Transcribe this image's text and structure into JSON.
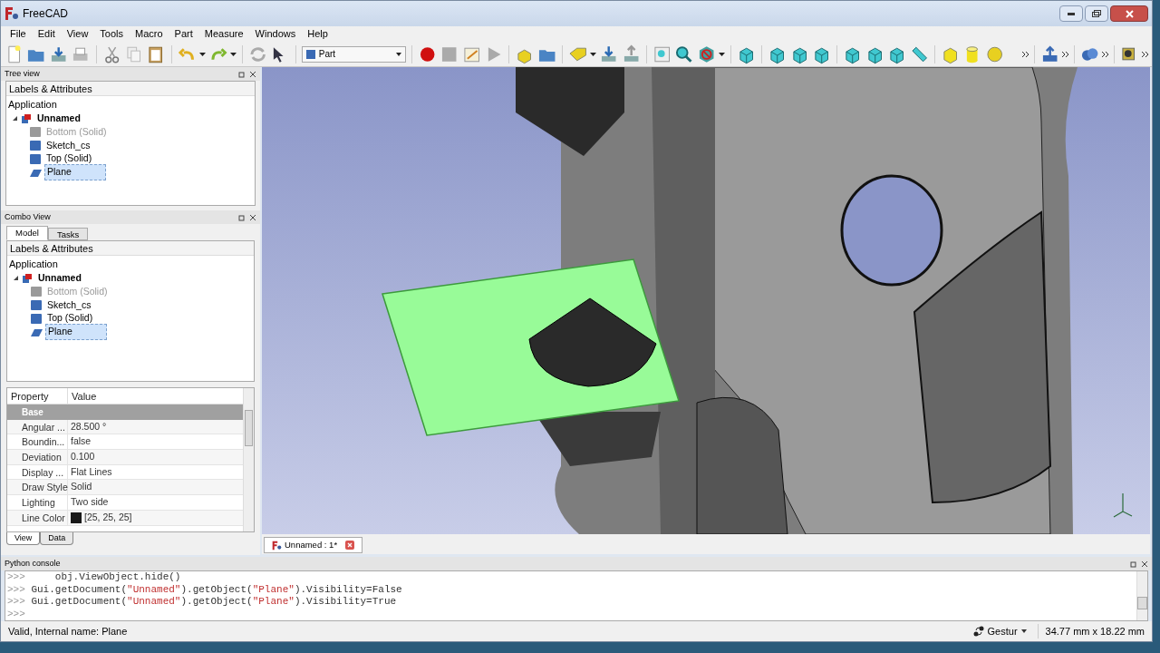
{
  "window": {
    "title": "FreeCAD"
  },
  "menu": [
    "File",
    "Edit",
    "View",
    "Tools",
    "Macro",
    "Part",
    "Measure",
    "Windows",
    "Help"
  ],
  "toolbar": {
    "workbench": "Part"
  },
  "tree_view": {
    "title": "Tree view",
    "header": "Labels & Attributes",
    "root": "Application",
    "items": [
      {
        "label": "Unnamed",
        "kind": "document",
        "expanded": true,
        "selected": false,
        "visible": true,
        "children": [
          {
            "label": "Bottom (Solid)",
            "kind": "solid",
            "selected": false,
            "visible": false
          },
          {
            "label": "Sketch_cs",
            "kind": "solid",
            "selected": false,
            "visible": true
          },
          {
            "label": "Top (Solid)",
            "kind": "solid",
            "selected": false,
            "visible": true
          },
          {
            "label": "Plane",
            "kind": "plane",
            "selected": true,
            "visible": true
          }
        ]
      }
    ]
  },
  "combo_view": {
    "title": "Combo View",
    "tabs": [
      {
        "label": "Model",
        "selected": true
      },
      {
        "label": "Tasks",
        "selected": false
      }
    ],
    "header": "Labels & Attributes",
    "root": "Application",
    "items": [
      {
        "label": "Unnamed",
        "kind": "document",
        "expanded": true,
        "selected": false,
        "visible": true,
        "children": [
          {
            "label": "Bottom (Solid)",
            "kind": "solid",
            "selected": false,
            "visible": false
          },
          {
            "label": "Sketch_cs",
            "kind": "solid",
            "selected": false,
            "visible": true
          },
          {
            "label": "Top (Solid)",
            "kind": "solid",
            "selected": false,
            "visible": true
          },
          {
            "label": "Plane",
            "kind": "plane",
            "selected": true,
            "visible": true
          }
        ]
      }
    ],
    "properties": {
      "columns": [
        "Property",
        "Value"
      ],
      "rows": [
        {
          "kind": "group",
          "name": "Base"
        },
        {
          "kind": "property",
          "name": "Angular ...",
          "value": "28.500 °"
        },
        {
          "kind": "property",
          "name": "Boundin...",
          "value": "false"
        },
        {
          "kind": "property",
          "name": "Deviation",
          "value": "0.100"
        },
        {
          "kind": "property",
          "name": "Display ...",
          "value": "Flat Lines"
        },
        {
          "kind": "property",
          "name": "Draw Style",
          "value": "Solid"
        },
        {
          "kind": "property",
          "name": "Lighting",
          "value": "Two side"
        },
        {
          "kind": "color",
          "name": "Line Color",
          "value": "[25, 25, 25]",
          "color": "#191919"
        }
      ]
    },
    "bottom_tabs": [
      {
        "label": "View",
        "selected": true
      },
      {
        "label": "Data",
        "selected": false
      }
    ]
  },
  "document_tabs": [
    {
      "label": "Unnamed : 1*",
      "selected": true
    }
  ],
  "python_console": {
    "title": "Python console",
    "lines": [
      [
        {
          "kind": "prompt",
          "text": ">>>"
        },
        {
          "kind": "code",
          "text": "     obj.ViewObject.hide()"
        }
      ],
      [
        {
          "kind": "prompt",
          "text": ">>>"
        },
        {
          "kind": "code",
          "text": " Gui.getDocument("
        },
        {
          "kind": "string",
          "text": "\"Unnamed\""
        },
        {
          "kind": "code",
          "text": ").getObject("
        },
        {
          "kind": "string",
          "text": "\"Plane\""
        },
        {
          "kind": "code",
          "text": ").Visibility=False"
        }
      ],
      [
        {
          "kind": "prompt",
          "text": ">>>"
        },
        {
          "kind": "code",
          "text": " Gui.getDocument("
        },
        {
          "kind": "string",
          "text": "\"Unnamed\""
        },
        {
          "kind": "code",
          "text": ").getObject("
        },
        {
          "kind": "string",
          "text": "\"Plane\""
        },
        {
          "kind": "code",
          "text": ").Visibility=True"
        }
      ],
      [
        {
          "kind": "prompt",
          "text": ">>>"
        }
      ]
    ]
  },
  "status_bar": {
    "message": "Valid, Internal name: Plane",
    "navigation": "Gestur",
    "dimensions": "34.77 mm x 18.22 mm"
  }
}
